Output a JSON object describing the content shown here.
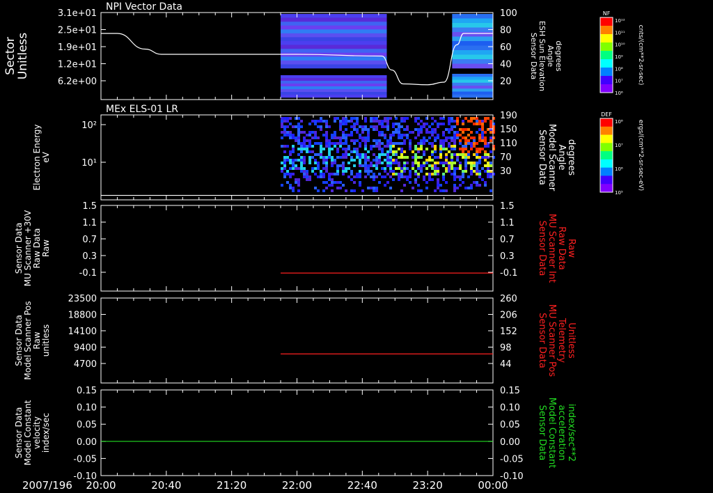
{
  "date_label": "2007/196",
  "time_ticks": [
    "20:00",
    "20:40",
    "21:20",
    "22:00",
    "22:40",
    "23:20",
    "00:00"
  ],
  "colors": {
    "red_trace": "#ff2020",
    "green_trace": "#22dd22",
    "frame": "#ffffff"
  },
  "chart_data": [
    {
      "type": "heatmap",
      "title": "NPI Vector Data",
      "ylabel": [
        "Sector",
        "Unitless"
      ],
      "y_ticks": [
        "3.1e+01",
        "2.5e+01",
        "1.9e+01",
        "1.2e+01",
        "6.2e+00"
      ],
      "right_ylabel": [
        "Sensor Data",
        "ESH Sun Elevation",
        "Angle",
        "degrees"
      ],
      "right_ticks": [
        "100",
        "80",
        "60",
        "40",
        "20"
      ],
      "right_ylim": [
        0,
        100
      ],
      "colorbar": {
        "label": "NF",
        "ticks": [
          "10¹²",
          "10¹¹",
          "10¹⁰",
          "10⁹",
          "10⁸",
          "10⁷",
          "10⁶"
        ],
        "units": "cnts/(cm**2-sr-sec)"
      },
      "data_blocks": [
        {
          "x_start": "21:50",
          "x_end": "22:55",
          "level": "blue/purple"
        },
        {
          "x_start": "23:35",
          "x_end": "00:00",
          "level": "cyan/blue"
        }
      ],
      "line_series": {
        "x": [
          "20:00",
          "20:10",
          "20:27",
          "20:37",
          "22:00",
          "22:52",
          "22:58",
          "23:05",
          "23:20",
          "23:30",
          "23:38",
          "23:42",
          "00:00"
        ],
        "y": [
          76,
          76,
          58,
          52,
          52,
          50,
          34,
          18,
          17,
          20,
          63,
          76,
          76
        ]
      }
    },
    {
      "type": "heatmap",
      "title": "MEx ELS-01 LR",
      "ylabel": [
        "Electron Energy",
        "eV"
      ],
      "y_ticks": [
        "10²",
        "10¹"
      ],
      "right_ylabel": [
        "Sensor Data",
        "Model Scanner",
        "Angle",
        "degrees"
      ],
      "right_ticks": [
        "190",
        "150",
        "110",
        "70",
        "30"
      ],
      "right_ylim": [
        0,
        190
      ],
      "colorbar": {
        "label": "DEF",
        "ticks": [
          "10⁸",
          "10⁷",
          "10⁶",
          "10⁵"
        ],
        "units": "ergs/(cm**2-sr-sec-eV)"
      },
      "line_series": {
        "x": [
          "20:00",
          "00:00"
        ],
        "y": [
          10,
          10
        ]
      }
    },
    {
      "type": "line",
      "ylabel": [
        "Sensor Data",
        "MU Scanner +30V",
        "Raw Data",
        "Raw"
      ],
      "y_ticks": [
        "1.5",
        "1.1",
        "0.7",
        "0.3",
        "-0.1"
      ],
      "right_ylabel": [
        "Sensor Data",
        "MU Scanner Int",
        "Raw Data",
        "Raw"
      ],
      "right_ticks": [
        "1.5",
        "1.1",
        "0.7",
        "0.3",
        "-0.1"
      ],
      "ylim": [
        -0.4,
        1.5
      ],
      "series": [
        {
          "x": [
            "21:50",
            "00:00"
          ],
          "y": [
            0,
            0
          ]
        }
      ]
    },
    {
      "type": "line",
      "ylabel": [
        "Sensor Data",
        "Model Scanner Pos",
        "Raw",
        "unitless"
      ],
      "y_ticks": [
        "23500",
        "18800",
        "14100",
        "9400",
        "4700"
      ],
      "right_ylabel": [
        "Sensor Data",
        "MU Scanner Pos",
        "Telemetry",
        "Unitless"
      ],
      "right_ticks": [
        "260",
        "206",
        "152",
        "98",
        "44"
      ],
      "right_ylim": [
        0,
        260
      ],
      "series": [
        {
          "x": [
            "21:50",
            "00:00"
          ],
          "y": [
            89,
            89
          ]
        }
      ]
    },
    {
      "type": "line",
      "ylabel": [
        "Sensor Data",
        "Model Constant",
        "velocity",
        "index/sec"
      ],
      "y_ticks": [
        "0.15",
        "0.10",
        "0.05",
        "0.00",
        "-0.05",
        "-0.10"
      ],
      "right_ylabel": [
        "Sensor Data",
        "Model Constant",
        "acceleration",
        "index/sec**2"
      ],
      "right_ticks": [
        "0.15",
        "0.10",
        "0.05",
        "0.00",
        "-0.05",
        "-0.10"
      ],
      "ylim": [
        -0.1,
        0.15
      ],
      "series": [
        {
          "x": [
            "20:00",
            "00:00"
          ],
          "y": [
            0,
            0
          ]
        }
      ]
    }
  ]
}
